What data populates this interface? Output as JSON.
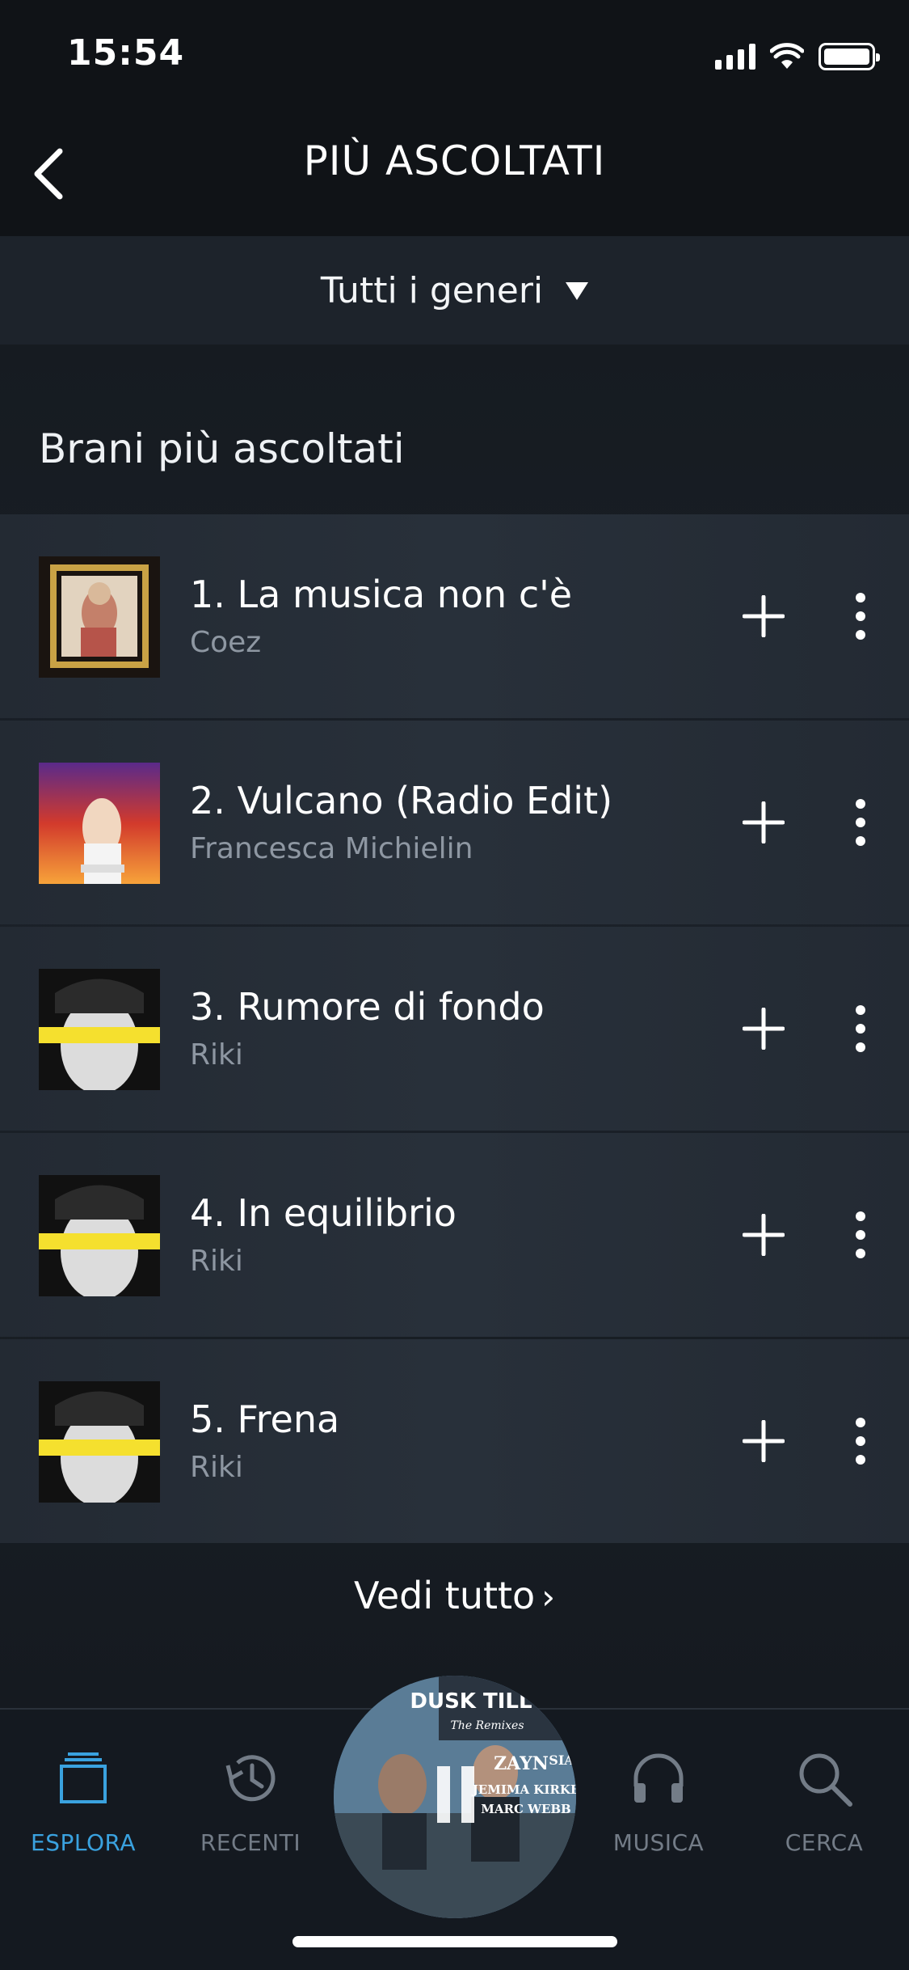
{
  "status_bar": {
    "time": "15:54"
  },
  "header": {
    "title": "PIÙ ASCOLTATI"
  },
  "genre_filter": {
    "label": "Tutti i generi"
  },
  "section": {
    "title": "Brani più ascoltati",
    "tracks": [
      {
        "title": "1. La musica non c'è",
        "artist": "Coez"
      },
      {
        "title": "2. Vulcano (Radio Edit)",
        "artist": "Francesca Michielin"
      },
      {
        "title": "3. Rumore di fondo",
        "artist": "Riki"
      },
      {
        "title": "4. In equilibrio",
        "artist": "Riki"
      },
      {
        "title": "5. Frena",
        "artist": "Riki"
      }
    ],
    "see_all": "Vedi tutto"
  },
  "tab_bar": {
    "tabs": [
      {
        "label": "ESPLORA",
        "icon": "browse-icon",
        "active": true
      },
      {
        "label": "RECENTI",
        "icon": "history-icon",
        "active": false
      },
      {
        "label": "MUSICA",
        "icon": "headphones-icon",
        "active": false
      },
      {
        "label": "CERCA",
        "icon": "search-icon",
        "active": false
      }
    ],
    "now_playing": {
      "cover_text": "DUSK TILL DAWN",
      "cover_subtitle": "The Remixes",
      "cover_artists": [
        "ZAYN",
        "SIA",
        "JEMIMA KIRKE",
        "MARC WEBB"
      ]
    }
  },
  "colors": {
    "accent": "#3aa2df",
    "background": "#0f1216",
    "row": "#262d36",
    "muted": "#8e97a2"
  }
}
